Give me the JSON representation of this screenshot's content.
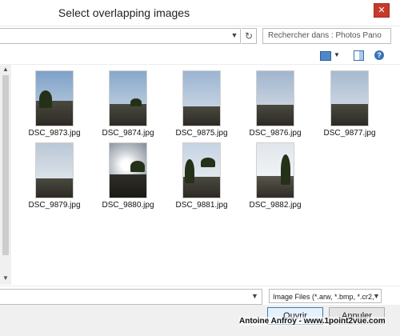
{
  "window": {
    "title": "Select overlapping images",
    "close_label": "✕"
  },
  "address": {
    "dropdown_icon": "chevron-down-icon",
    "refresh_icon": "refresh-icon",
    "refresh_glyph": "↻"
  },
  "search": {
    "placeholder": "Rechercher dans : Photos Pano"
  },
  "toolbar": {
    "view_icon": "view-options-icon",
    "preview_icon": "preview-pane-icon",
    "help_glyph": "?"
  },
  "files": [
    {
      "name": "DSC_9873.jpg"
    },
    {
      "name": "DSC_9874.jpg"
    },
    {
      "name": "DSC_9875.jpg"
    },
    {
      "name": "DSC_9876.jpg"
    },
    {
      "name": "DSC_9877.jpg"
    },
    {
      "name": "DSC_9879.jpg"
    },
    {
      "name": "DSC_9880.jpg"
    },
    {
      "name": "DSC_9881.jpg"
    },
    {
      "name": "DSC_9882.jpg"
    }
  ],
  "filter": {
    "selected": "Image Files (*.arw, *.bmp, *.cr2,"
  },
  "buttons": {
    "open": "Ouvrir",
    "cancel": "Annuler"
  },
  "watermark": "Antoine Anfroy - www.1point2vue.com",
  "colors": {
    "close_red": "#c7392b",
    "accent_blue": "#3c7fb1"
  }
}
